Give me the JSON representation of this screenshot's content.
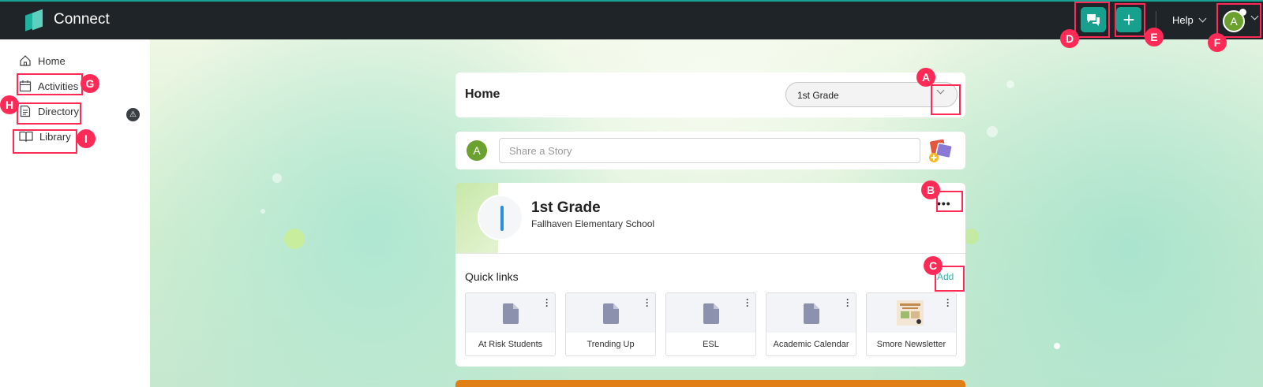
{
  "app": {
    "name": "Connect"
  },
  "topbar": {
    "help_label": "Help",
    "avatar_initial": "A"
  },
  "sidebar": {
    "items": [
      {
        "label": "Home"
      },
      {
        "label": "Activities"
      },
      {
        "label": "Directory"
      },
      {
        "label": "Library"
      }
    ]
  },
  "home_card": {
    "title": "Home",
    "grade_selected": "1st Grade"
  },
  "story": {
    "avatar_initial": "A",
    "placeholder": "Share a Story"
  },
  "group": {
    "name": "1st Grade",
    "school": "Fallhaven Elementary School",
    "more_label": "•••",
    "quick_links_title": "Quick links",
    "add_label": "Add",
    "quick_links": [
      {
        "label": "At Risk Students"
      },
      {
        "label": "Trending Up"
      },
      {
        "label": "ESL"
      },
      {
        "label": "Academic Calendar"
      },
      {
        "label": "Smore Newsletter"
      }
    ]
  },
  "annotations": [
    "A",
    "B",
    "C",
    "D",
    "E",
    "F",
    "G",
    "H",
    "I"
  ],
  "colors": {
    "accent": "#17a08e",
    "topbar": "#1e2428",
    "marker": "#ff2a55",
    "avatar": "#6aa12f"
  }
}
